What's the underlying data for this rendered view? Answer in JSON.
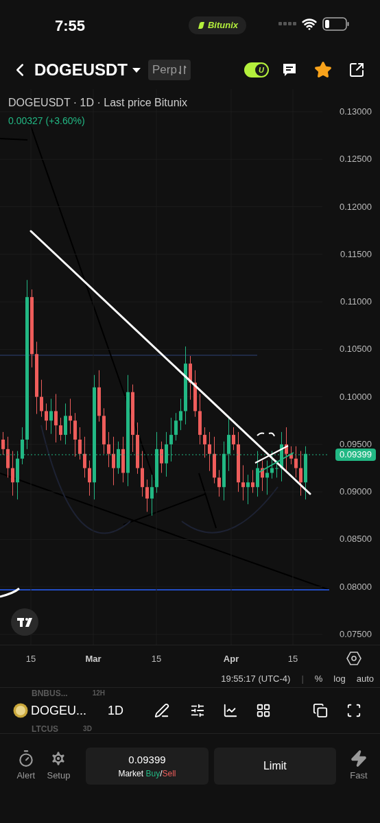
{
  "status_bar": {
    "time": "7:55",
    "app_pill": "Bitunix"
  },
  "header": {
    "symbol": "DOGEUSDT",
    "type_badge": "Perp",
    "unit_toggle": {
      "label": "U",
      "on": true
    },
    "favorite": true
  },
  "chart": {
    "legend": "DOGEUSDT · 1D · Last price Bitunix",
    "change": "0.00327 (+3.60%)",
    "last_price": "0.09399",
    "chart_data": {
      "type": "candlestick",
      "categories": [
        null,
        null,
        null,
        null,
        null,
        null,
        null,
        null,
        null,
        null,
        null,
        null,
        null,
        null,
        null,
        null,
        null,
        null,
        null,
        null,
        null,
        null,
        null,
        null,
        null,
        null,
        null,
        null,
        null,
        null,
        null,
        null,
        null,
        null,
        null,
        null,
        null,
        null,
        null,
        null,
        null,
        null,
        null,
        null,
        null,
        null,
        null,
        null,
        null,
        null,
        null,
        null,
        null,
        null,
        null,
        null,
        null,
        null,
        null,
        null,
        null,
        null,
        null,
        null
      ],
      "ylim": [
        0.075,
        0.13
      ],
      "grid": true,
      "yticks": [
        {
          "value": 0.13,
          "label": "0.13000"
        },
        {
          "value": 0.125,
          "label": "0.12500"
        },
        {
          "value": 0.12,
          "label": "0.12000"
        },
        {
          "value": 0.115,
          "label": "0.11500"
        },
        {
          "value": 0.11,
          "label": "0.11000"
        },
        {
          "value": 0.105,
          "label": "0.10500"
        },
        {
          "value": 0.1,
          "label": "0.10000"
        },
        {
          "value": 0.095,
          "label": "0.09500"
        },
        {
          "value": 0.09,
          "label": "0.09000"
        },
        {
          "value": 0.085,
          "label": "0.08500"
        },
        {
          "value": 0.08,
          "label": "0.08000"
        },
        {
          "value": 0.075,
          "label": "0.07500"
        }
      ],
      "ohlc": [
        [
          0.0955,
          0.0963,
          0.0939,
          0.0945
        ],
        [
          0.0945,
          0.0958,
          0.0915,
          0.0925
        ],
        [
          0.0925,
          0.0943,
          0.0896,
          0.091
        ],
        [
          0.091,
          0.0943,
          0.0892,
          0.0935
        ],
        [
          0.0935,
          0.0968,
          0.0929,
          0.0955
        ],
        [
          0.0955,
          0.1123,
          0.0945,
          0.1105
        ],
        [
          0.1105,
          0.1113,
          0.1031,
          0.1045
        ],
        [
          0.1045,
          0.1058,
          0.0982,
          0.1
        ],
        [
          0.1,
          0.1018,
          0.0979,
          0.0985
        ],
        [
          0.0985,
          0.0993,
          0.0965,
          0.0975
        ],
        [
          0.0975,
          0.0998,
          0.0961,
          0.0985
        ],
        [
          0.0985,
          0.1003,
          0.0952,
          0.097
        ],
        [
          0.097,
          0.0978,
          0.0954,
          0.096
        ],
        [
          0.096,
          0.0993,
          0.095,
          0.098
        ],
        [
          0.098,
          0.0998,
          0.0961,
          0.0975
        ],
        [
          0.0975,
          0.0983,
          0.0937,
          0.0955
        ],
        [
          0.0955,
          0.0968,
          0.0934,
          0.094
        ],
        [
          0.094,
          0.0958,
          0.0915,
          0.0925
        ],
        [
          0.0925,
          0.0933,
          0.0896,
          0.091
        ],
        [
          0.091,
          0.1023,
          0.0892,
          0.101
        ],
        [
          0.101,
          0.1028,
          0.0974,
          0.098
        ],
        [
          0.098,
          0.0988,
          0.094,
          0.095
        ],
        [
          0.095,
          0.0963,
          0.0926,
          0.094
        ],
        [
          0.094,
          0.0958,
          0.0907,
          0.0925
        ],
        [
          0.0925,
          0.0953,
          0.0919,
          0.0945
        ],
        [
          0.0945,
          0.0958,
          0.091,
          0.092
        ],
        [
          0.092,
          0.1023,
          0.0906,
          0.1005
        ],
        [
          0.1005,
          0.1013,
          0.0942,
          0.096
        ],
        [
          0.096,
          0.0973,
          0.0919,
          0.0925
        ],
        [
          0.0925,
          0.0943,
          0.0895,
          0.0905
        ],
        [
          0.0905,
          0.0913,
          0.0879,
          0.0893
        ],
        [
          0.0893,
          0.0918,
          0.0875,
          0.0905
        ],
        [
          0.0905,
          0.0963,
          0.0899,
          0.0945
        ],
        [
          0.0945,
          0.0953,
          0.092,
          0.093
        ],
        [
          0.093,
          0.0963,
          0.0916,
          0.095
        ],
        [
          0.095,
          0.0978,
          0.0932,
          0.096
        ],
        [
          0.096,
          0.0983,
          0.0954,
          0.0975
        ],
        [
          0.0975,
          0.0998,
          0.0965,
          0.0985
        ],
        [
          0.0985,
          0.1053,
          0.0971,
          0.1035
        ],
        [
          0.1035,
          0.1043,
          0.0997,
          0.1015
        ],
        [
          0.1015,
          0.1028,
          0.0979,
          0.0985
        ],
        [
          0.0985,
          0.1003,
          0.095,
          0.096
        ],
        [
          0.096,
          0.0968,
          0.0936,
          0.095
        ],
        [
          0.095,
          0.0963,
          0.0922,
          0.094
        ],
        [
          0.094,
          0.0958,
          0.0909,
          0.0915
        ],
        [
          0.0915,
          0.0923,
          0.0895,
          0.0905
        ],
        [
          0.0905,
          0.0953,
          0.0891,
          0.094
        ],
        [
          0.094,
          0.0978,
          0.0922,
          0.096
        ],
        [
          0.096,
          0.0968,
          0.0944,
          0.095
        ],
        [
          0.095,
          0.0963,
          0.09,
          0.091
        ],
        [
          0.091,
          0.0928,
          0.0891,
          0.0905
        ],
        [
          0.0905,
          0.0918,
          0.0887,
          0.091
        ],
        [
          0.091,
          0.0923,
          0.0899,
          0.0905
        ],
        [
          0.0905,
          0.0943,
          0.0895,
          0.0925
        ],
        [
          0.0925,
          0.0933,
          0.0901,
          0.0915
        ],
        [
          0.0915,
          0.0933,
          0.0897,
          0.092
        ],
        [
          0.092,
          0.0943,
          0.0914,
          0.0925
        ],
        [
          0.0925,
          0.0933,
          0.0915,
          0.0925
        ],
        [
          0.0925,
          0.0963,
          0.0911,
          0.095
        ],
        [
          0.095,
          0.0968,
          0.0922,
          0.094
        ],
        [
          0.094,
          0.0948,
          0.0929,
          0.0935
        ],
        [
          0.0935,
          0.0948,
          0.0915,
          0.0925
        ],
        [
          0.0925,
          0.0943,
          0.0896,
          0.091
        ],
        [
          0.091,
          0.0948,
          0.0892,
          0.094
        ]
      ]
    },
    "date_ticks": [
      {
        "label": "15",
        "bold": false
      },
      {
        "label": "Mar",
        "bold": true
      },
      {
        "label": "15",
        "bold": false
      },
      {
        "label": "Apr",
        "bold": true
      },
      {
        "label": "15",
        "bold": false
      }
    ]
  },
  "chart_footer": {
    "time": "19:55:17 (UTC-4)",
    "separator": "|",
    "options": [
      "%",
      "log",
      "auto"
    ]
  },
  "toolbar": {
    "symbol": "DOGEU...",
    "interval": "1D",
    "ghost_rows": [
      {
        "symbol": "BNBUS...",
        "interval": "12H"
      },
      {
        "symbol": "LTCUS",
        "interval": "3D"
      }
    ]
  },
  "bottom_bar": {
    "actions": [
      {
        "label": "Alert",
        "kind": "alert"
      },
      {
        "label": "Setup",
        "kind": "setup"
      }
    ],
    "market": {
      "price": "0.09399",
      "label": "Market",
      "buy": "Buy",
      "slash": "/",
      "sell": "Sell"
    },
    "limit": "Limit",
    "fast": "Fast"
  }
}
